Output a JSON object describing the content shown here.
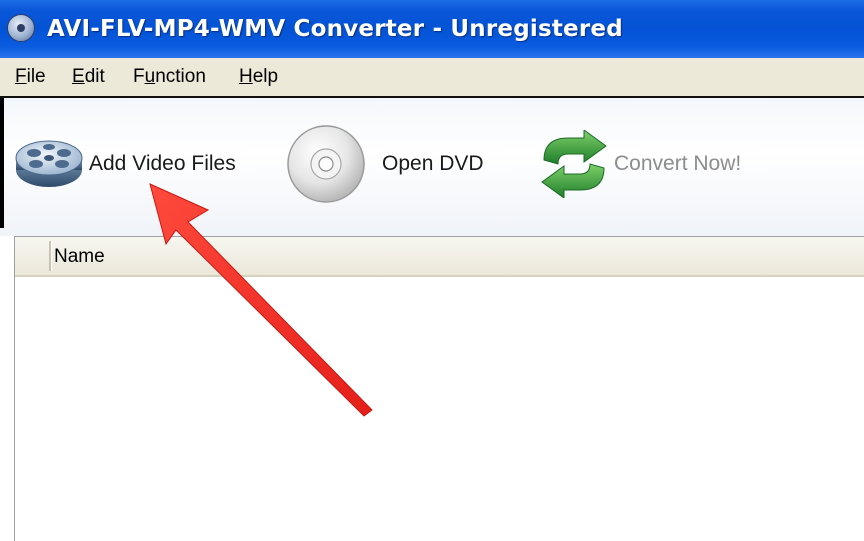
{
  "window": {
    "title": "AVI-FLV-MP4-WMV Converter - Unregistered"
  },
  "menu": {
    "items": [
      {
        "label": "File",
        "accel": "F",
        "rest": "ile"
      },
      {
        "label": "Edit",
        "accel": "E",
        "rest": "dit"
      },
      {
        "label": "Function",
        "pre": "F",
        "accel": "u",
        "rest": "nction"
      },
      {
        "label": "Help",
        "accel": "H",
        "rest": "elp"
      }
    ]
  },
  "toolbar": {
    "add_video_label": "Add Video Files",
    "open_dvd_label": "Open DVD",
    "convert_now_label": "Convert Now!"
  },
  "file_list": {
    "column_name": "Name",
    "rows": []
  },
  "colors": {
    "title_bar": "#0453d6",
    "menu_bar": "#ece9d8",
    "annotation_arrow": "#f2312a",
    "convert_icon": "#2e9e3a"
  },
  "annotation": {
    "type": "arrow",
    "points_to": "add-video-files-button"
  }
}
